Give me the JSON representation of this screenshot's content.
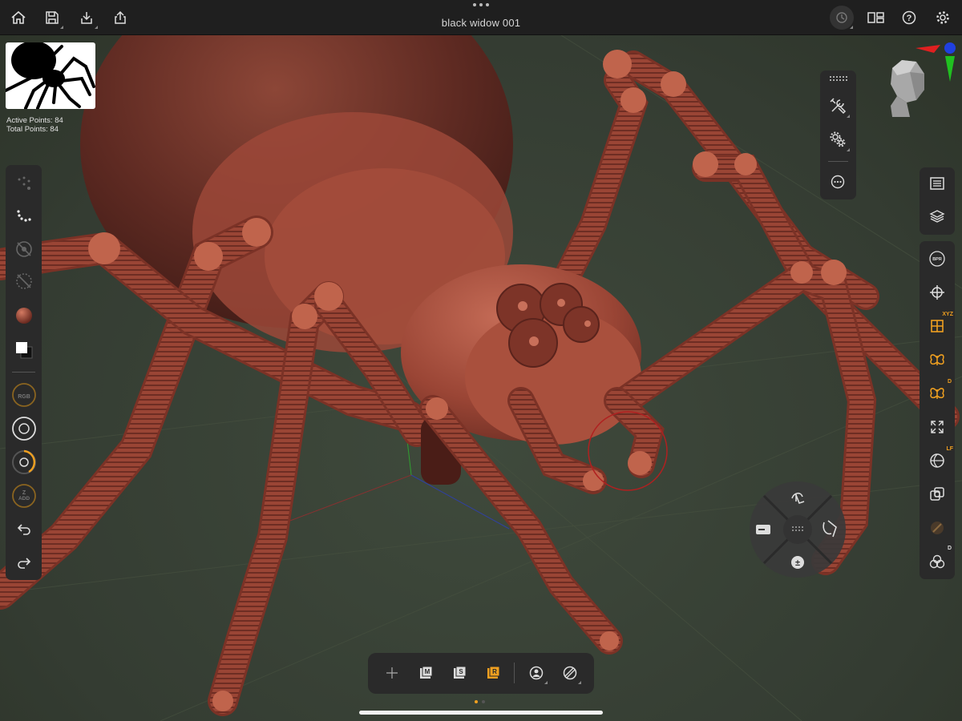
{
  "app": {
    "document_title": "black widow 001"
  },
  "stats": {
    "active_points": "Active Points: 84",
    "total_points": "Total Points: 84"
  },
  "left_toolbar": {
    "rgb_label": "RGB",
    "zadd_label": "ADD",
    "zadd_prefix": "Z"
  },
  "right_toolbar": {
    "bpr_label": "BPR",
    "xyz_label": "XYZ",
    "d_label": "D",
    "lf_label": "LF",
    "d2_label": "D"
  },
  "colors": {
    "accent": "#f0a020",
    "panel": "#2a2a2a",
    "topbar": "#1f1f1f",
    "model": "#8a3a2c",
    "grid": "#3a4236"
  },
  "icons": [
    "home-icon",
    "save-icon",
    "import-icon",
    "share-icon",
    "history-icon",
    "layout-icon",
    "help-icon",
    "settings-icon"
  ],
  "page_indicator": {
    "pages": 2,
    "current": 1
  }
}
